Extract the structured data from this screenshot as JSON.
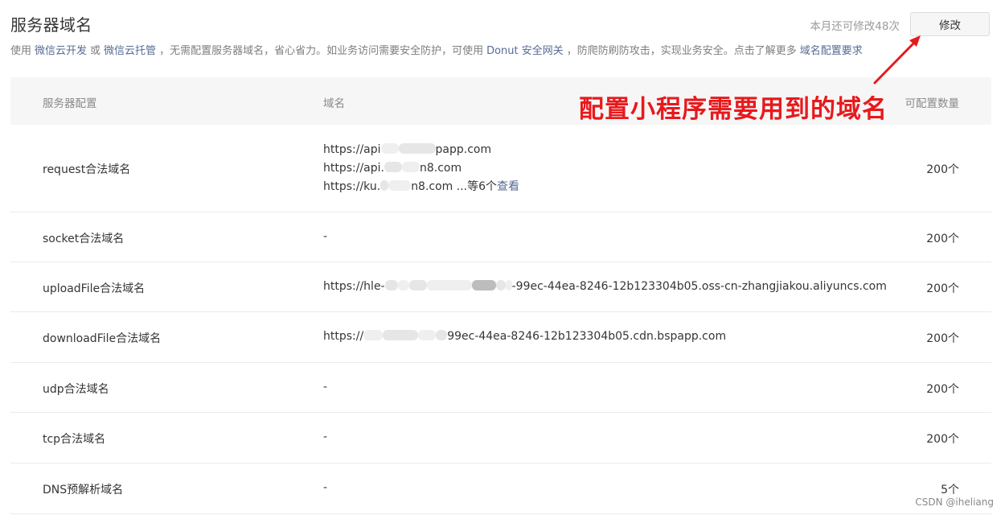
{
  "header": {
    "title": "服务器域名",
    "quota_text": "本月还可修改48次",
    "edit_button": "修改"
  },
  "description": {
    "t1": "使用",
    "link1": "微信云开发",
    "t2": "或",
    "link2": "微信云托管",
    "t3": "，无需配置服务器域名，省心省力。如业务访问需要安全防护，可使用",
    "link3": "Donut 安全网关",
    "t4": "，防爬防刷防攻击，实现业务安全。点击了解更多",
    "link4": "域名配置要求"
  },
  "table": {
    "headers": [
      "服务器配置",
      "域名",
      "可配置数量"
    ],
    "rows": [
      {
        "name": "request合法域名",
        "lines": [
          "https://api",
          "papp.com",
          "https://api.",
          "n8.com",
          "https://ku.",
          "n8.com ...等6个",
          "查看"
        ],
        "count": "200个"
      },
      {
        "name": "socket合法域名",
        "value": "-",
        "count": "200个"
      },
      {
        "name": "uploadFile合法域名",
        "value_prefix": "https://hle-",
        "value_suffix": "-99ec-44ea-8246-12b123304b05.oss-cn-zhangjiakou.aliyuncs.com",
        "count": "200个"
      },
      {
        "name": "downloadFile合法域名",
        "value_prefix": "https://",
        "value_suffix": "99ec-44ea-8246-12b123304b05.cdn.bspapp.com",
        "count": "200个"
      },
      {
        "name": "udp合法域名",
        "value": "-",
        "count": "200个"
      },
      {
        "name": "tcp合法域名",
        "value": "-",
        "count": "200个"
      },
      {
        "name": "DNS预解析域名",
        "value": "-",
        "count": "5个"
      }
    ]
  },
  "annotation": {
    "text": "配置小程序需要用到的域名",
    "color": "#e8191c"
  },
  "watermark": "CSDN @iheliang",
  "colors": {
    "link": "#576b95",
    "header_bg": "#f6f6f6"
  }
}
